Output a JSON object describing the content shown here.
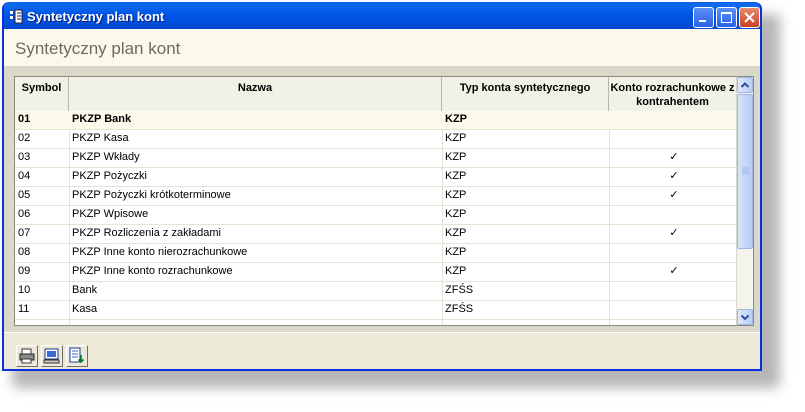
{
  "window": {
    "title": "Syntetyczny plan kont",
    "accent_color": "#0050dc",
    "controls": [
      "minimize-icon",
      "maximize-icon",
      "close-icon"
    ]
  },
  "page": {
    "title": "Syntetyczny plan kont"
  },
  "table": {
    "columns": [
      "Symbol",
      "Nazwa",
      "Typ konta syntetycznego",
      "Konto rozrachunkowe z kontrahentem"
    ],
    "rows": [
      {
        "symbol": "01",
        "nazwa": "PKZP Bank",
        "typ": "KZP",
        "rozrachunkowe": ""
      },
      {
        "symbol": "02",
        "nazwa": "PKZP Kasa",
        "typ": "KZP",
        "rozrachunkowe": ""
      },
      {
        "symbol": "03",
        "nazwa": "PKZP Wkłady",
        "typ": "KZP",
        "rozrachunkowe": "✓"
      },
      {
        "symbol": "04",
        "nazwa": "PKZP Pożyczki",
        "typ": "KZP",
        "rozrachunkowe": "✓"
      },
      {
        "symbol": "05",
        "nazwa": "PKZP Pożyczki krótkoterminowe",
        "typ": "KZP",
        "rozrachunkowe": "✓"
      },
      {
        "symbol": "06",
        "nazwa": "PKZP Wpisowe",
        "typ": "KZP",
        "rozrachunkowe": ""
      },
      {
        "symbol": "07",
        "nazwa": "PKZP Rozliczenia z zakładami",
        "typ": "KZP",
        "rozrachunkowe": "✓"
      },
      {
        "symbol": "08",
        "nazwa": "PKZP Inne konto nierozrachunkowe",
        "typ": "KZP",
        "rozrachunkowe": ""
      },
      {
        "symbol": "09",
        "nazwa": "PKZP Inne konto rozrachunkowe",
        "typ": "KZP",
        "rozrachunkowe": "✓"
      },
      {
        "symbol": "10",
        "nazwa": "Bank",
        "typ": "ZFŚS",
        "rozrachunkowe": ""
      },
      {
        "symbol": "11",
        "nazwa": "Kasa",
        "typ": "ZFŚS",
        "rozrachunkowe": ""
      }
    ]
  },
  "footer": {
    "buttons": [
      "printer-icon",
      "computer-icon",
      "export-icon"
    ]
  }
}
